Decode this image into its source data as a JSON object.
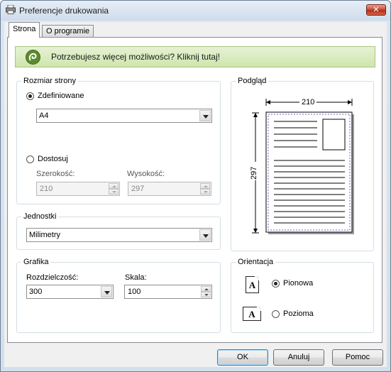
{
  "window": {
    "title": "Preferencje drukowania",
    "close_glyph": "✕"
  },
  "tabs": [
    {
      "label": "Strona",
      "active": true
    },
    {
      "label": "O programie",
      "active": false
    }
  ],
  "banner": {
    "text": "Potrzebujesz więcej możliwości? Kliknij tutaj!",
    "icon": "printer-brand-icon"
  },
  "page_size": {
    "legend": "Rozmiar strony",
    "predefined_label": "Zdefiniowane",
    "predefined_checked": true,
    "predefined_value": "A4",
    "custom_label": "Dostosuj",
    "custom_checked": false,
    "width_label": "Szerokość:",
    "width_value": "210",
    "height_label": "Wysokość:",
    "height_value": "297"
  },
  "units": {
    "legend": "Jednostki",
    "value": "Milimetry"
  },
  "graphics": {
    "legend": "Grafika",
    "resolution_label": "Rozdzielczość:",
    "resolution_value": "300",
    "scale_label": "Skala:",
    "scale_value": "100"
  },
  "preview": {
    "legend": "Podgląd",
    "width_dim": "210",
    "height_dim": "297"
  },
  "orientation": {
    "legend": "Orientacja",
    "portrait_label": "Pionowa",
    "portrait_checked": true,
    "landscape_label": "Pozioma",
    "landscape_checked": false,
    "icon_letter": "A"
  },
  "buttons": {
    "ok": "OK",
    "cancel": "Anuluj",
    "help": "Pomoc"
  },
  "colors": {
    "banner_bg": "#cfe5ae",
    "default_button_border": "#3c7fb1",
    "close_button": "#c9472f"
  }
}
